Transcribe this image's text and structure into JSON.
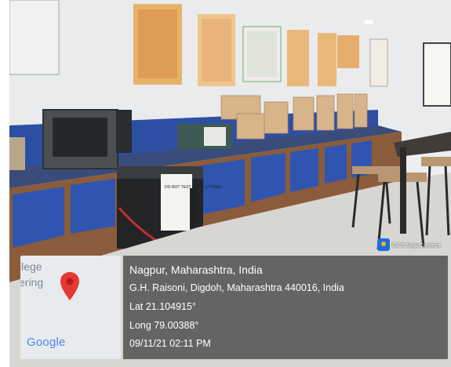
{
  "geotag": {
    "city_line": "Nagpur, Maharashtra, India",
    "address_line": "G.H. Raisoni, Digdoh, Maharashtra 440016, India",
    "latitude": "Lat 21.104915°",
    "longitude": "Long 79.00388°",
    "datetime": "09/11/21 02:11 PM"
  },
  "map_thumbnail": {
    "label_line1": "llege",
    "label_line2": "ering",
    "provider": "Google",
    "pin_icon": "map-pin-icon",
    "pin_color": "#e53935"
  },
  "app_badge": {
    "label": "GPS Map Camera",
    "icon": "camera-app-icon"
  },
  "notice_paper": {
    "text": "DO NOT TEST PERFECT FREE"
  },
  "colors": {
    "cabinet_blue": "#2a4a9a",
    "cabinet_frame": "#8a5a3a",
    "wall": "#eef0f2"
  }
}
